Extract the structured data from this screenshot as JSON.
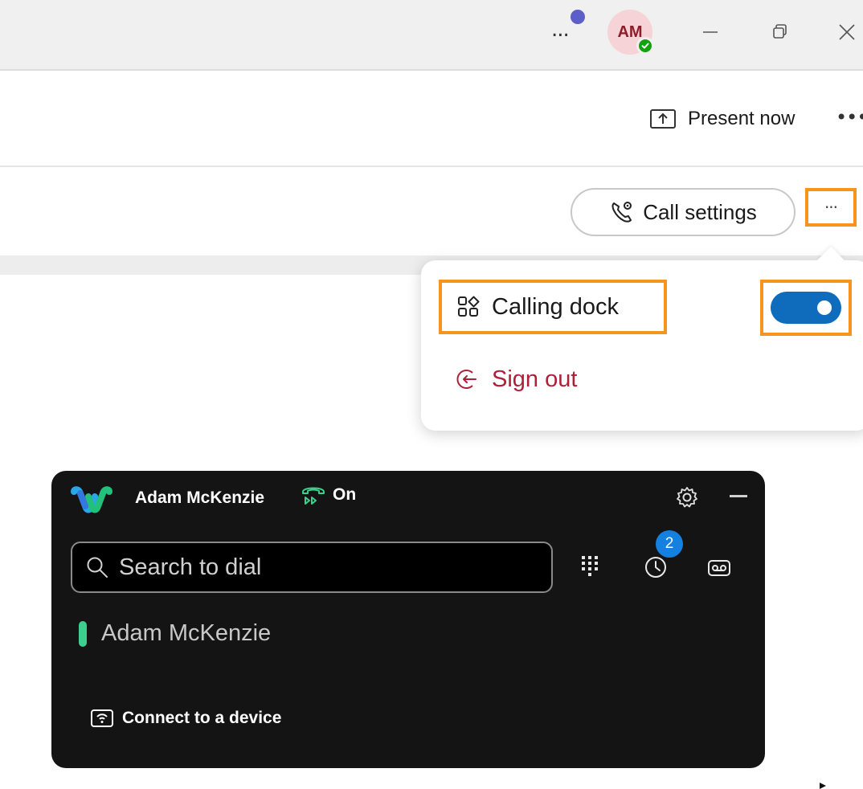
{
  "titlebar": {
    "more_label": "...",
    "avatar_initials": "AM",
    "presence_color": "#13a10e",
    "notification_dot_color": "#5b5fc7"
  },
  "meeting_toolbar": {
    "present_label": "Present now",
    "more_label": "•••"
  },
  "call_row": {
    "call_settings_label": "Call settings",
    "more_label": "···"
  },
  "popover": {
    "calling_dock_label": "Calling dock",
    "calling_dock_enabled": true,
    "sign_out_label": "Sign out",
    "sign_out_color": "#b01f3a",
    "toggle_color": "#0f6cbd"
  },
  "dock": {
    "user_name": "Adam McKenzie",
    "status_label": "On",
    "search_placeholder": "Search to dial",
    "history_badge": "2",
    "line_name": "Adam McKenzie",
    "line_color": "#3ccf8e",
    "connect_label": "Connect to a device",
    "background": "#141414"
  },
  "highlight_color": "#f7941d"
}
